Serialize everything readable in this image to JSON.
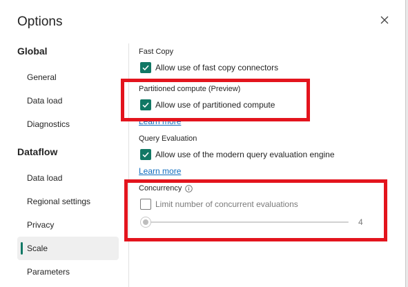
{
  "dialog": {
    "title": "Options",
    "close_icon": "close-icon"
  },
  "nav": {
    "global_heading": "Global",
    "global_items": [
      {
        "label": "General"
      },
      {
        "label": "Data load"
      },
      {
        "label": "Diagnostics"
      }
    ],
    "dataflow_heading": "Dataflow",
    "dataflow_items": [
      {
        "label": "Data load"
      },
      {
        "label": "Regional settings"
      },
      {
        "label": "Privacy"
      },
      {
        "label": "Scale",
        "selected": true
      },
      {
        "label": "Parameters"
      }
    ]
  },
  "content": {
    "fast_copy": {
      "title": "Fast Copy",
      "checkbox_label": "Allow use of fast copy connectors",
      "checked": true
    },
    "partitioned_compute": {
      "title": "Partitioned compute (Preview)",
      "checkbox_label": "Allow use of partitioned compute",
      "checked": true,
      "learn_more": "Learn more"
    },
    "query_evaluation": {
      "title": "Query Evaluation",
      "checkbox_label": "Allow use of the modern query evaluation engine",
      "checked": true,
      "learn_more": "Learn more"
    },
    "concurrency": {
      "title": "Concurrency",
      "info_icon": "info-icon",
      "checkbox_label": "Limit number of concurrent evaluations",
      "checked": false,
      "slider_value": "4"
    }
  },
  "colors": {
    "accent": "#117865",
    "link": "#0f6cbd",
    "highlight": "#e3141d"
  }
}
